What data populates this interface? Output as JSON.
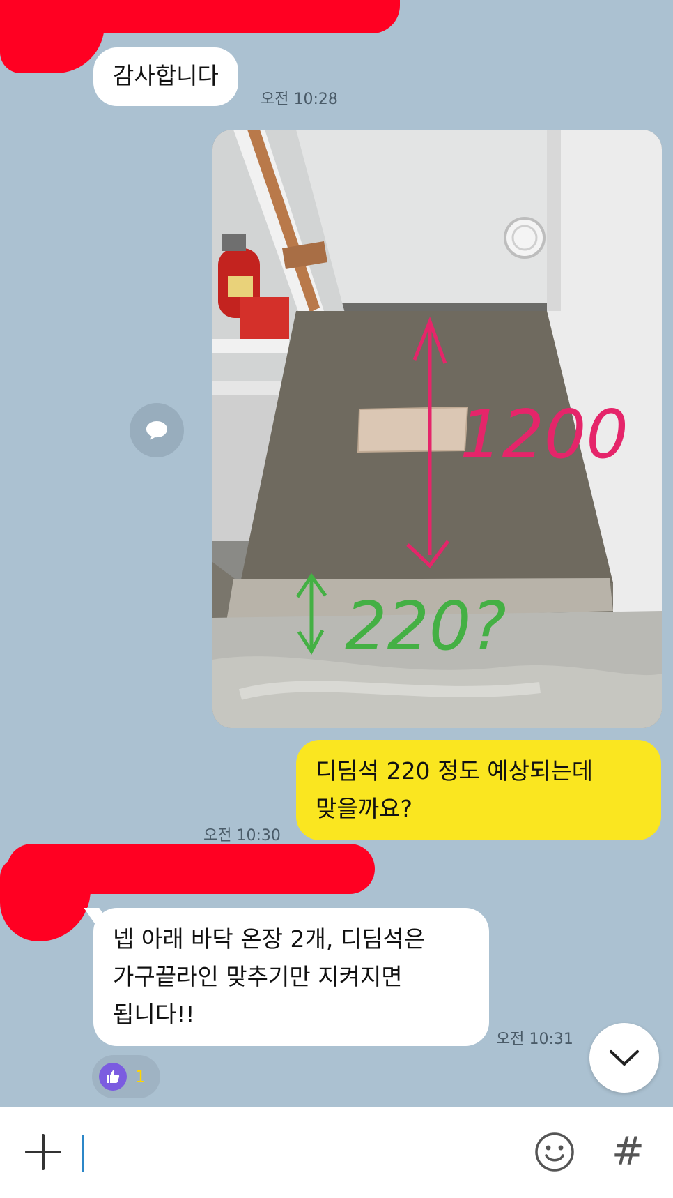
{
  "messages": [
    {
      "sender": "other",
      "text": "감사합니다",
      "time": "오전 10:28"
    },
    {
      "sender": "me",
      "type": "photo",
      "annotations": [
        "1200",
        "220?"
      ]
    },
    {
      "sender": "me",
      "text": "디딤석  220 정도 예상되는데\n맞을까요?",
      "time": "오전 10:30"
    },
    {
      "sender": "other",
      "text": "넵 아래 바닥 온장 2개, 디딤석은\n가구끝라인 맞추기만 지켜지면\n됩니다!!",
      "time": "오전 10:31"
    }
  ],
  "reaction": {
    "icon": "thumbs-up-icon",
    "count": "1"
  },
  "icons": {
    "share": "speech-bubble-icon",
    "scroll": "chevron-down-icon",
    "attach": "plus-icon",
    "emoji": "smiley-icon",
    "hashtag": "#"
  },
  "input": {
    "placeholder": ""
  },
  "colors": {
    "background": "#abc1d1",
    "incoming_bubble": "#ffffff",
    "outgoing_bubble": "#fae620",
    "redaction": "#ff0022",
    "reaction_accent": "#7b5ce0"
  }
}
